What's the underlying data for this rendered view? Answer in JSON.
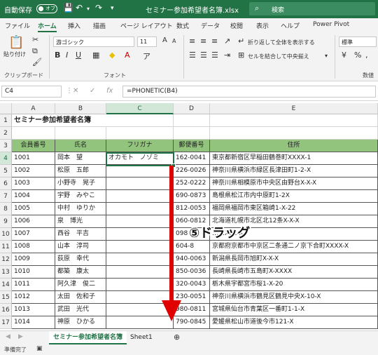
{
  "titlebar": {
    "autosave": "自動保存",
    "toggle": "オフ",
    "filename": "セミナー参加希望者名簿.xlsx",
    "search": "検索"
  },
  "menu": [
    "ファイル",
    "ホーム",
    "挿入",
    "描画",
    "ページ レイアウト",
    "数式",
    "データ",
    "校閲",
    "表示",
    "ヘルプ",
    "Power Pivot"
  ],
  "ribbon": {
    "paste": "貼り付け",
    "clipboard": "クリップボード",
    "font_name": "游ゴシック",
    "font_size": "11",
    "font_group": "フォント",
    "wrap_text": "折り返して全体を表示する",
    "merge_center": "セルを結合して中央揃え",
    "number_format": "標準",
    "number_group": "数値"
  },
  "formula": {
    "namebox": "C4",
    "value": "=PHONETIC(B4)"
  },
  "columns": [
    "A",
    "B",
    "C",
    "D",
    "E"
  ],
  "sheet_title": "セミナー参加希望者名簿",
  "headers": [
    "会員番号",
    "氏名",
    "フリガナ",
    "郵便番号",
    "住所"
  ],
  "rows": [
    {
      "num": "1001",
      "name": "岡本　望",
      "kana": "オカモト　ノゾミ",
      "zip": "162-0041",
      "addr": "東京都新宿区早稲田鶴巻町XXXX-1"
    },
    {
      "num": "1002",
      "name": "松原　五郎",
      "kana": "",
      "zip": "226-0026",
      "addr": "神奈川県横浜市緑区長津田町1-2-X"
    },
    {
      "num": "1003",
      "name": "小野寺　晃子",
      "kana": "",
      "zip": "252-0222",
      "addr": "神奈川県相模原市中央区由野台X-X-X"
    },
    {
      "num": "1004",
      "name": "宇野　みやこ",
      "kana": "",
      "zip": "690-0873",
      "addr": "島根県松江市内中原町1-2X"
    },
    {
      "num": "1005",
      "name": "中村　ゆりか",
      "kana": "",
      "zip": "812-0053",
      "addr": "福岡県福岡市東区箱崎1-X-22"
    },
    {
      "num": "1006",
      "name": "泉　博光",
      "kana": "",
      "zip": "060-0812",
      "addr": "北海道札幌市北区北12条X-X-X"
    },
    {
      "num": "1007",
      "name": "西谷　平吉",
      "kana": "",
      "zip": "098",
      "addr": "……X01-X"
    },
    {
      "num": "1008",
      "name": "山本　淳司",
      "kana": "",
      "zip": "604-8",
      "addr": "京都府京都市中京区二条通二ノ京下合町XXXX-X"
    },
    {
      "num": "1009",
      "name": "荻原　幸代",
      "kana": "",
      "zip": "940-0063",
      "addr": "新潟県長岡市旭町X-X-X"
    },
    {
      "num": "1010",
      "name": "都築　康太",
      "kana": "",
      "zip": "850-0036",
      "addr": "長崎県長崎市五島町X-XXXX"
    },
    {
      "num": "1011",
      "name": "阿久津　俊二",
      "kana": "",
      "zip": "320-0043",
      "addr": "栃木県宇都宮市桜1-X-20"
    },
    {
      "num": "1012",
      "name": "太田　佐和子",
      "kana": "",
      "zip": "230-0051",
      "addr": "神奈川県横浜市鶴見区鶴見中央X-10-X"
    },
    {
      "num": "1013",
      "name": "武田　光代",
      "kana": "",
      "zip": "980-0811",
      "addr": "宮城県仙台市青葉区一番町1-1-X"
    },
    {
      "num": "1014",
      "name": "神原　ひかる",
      "kana": "",
      "zip": "790-0845",
      "addr": "愛媛県松山市道後今市121-X"
    }
  ],
  "annotation": "⑤ドラッグ",
  "sheets": [
    "セミナー参加希望者名簿",
    "Sheet1"
  ],
  "status": "準備完了",
  "colors": {
    "accent": "#217346",
    "header_fill": "#92c47d",
    "arrow": "#e00000"
  }
}
